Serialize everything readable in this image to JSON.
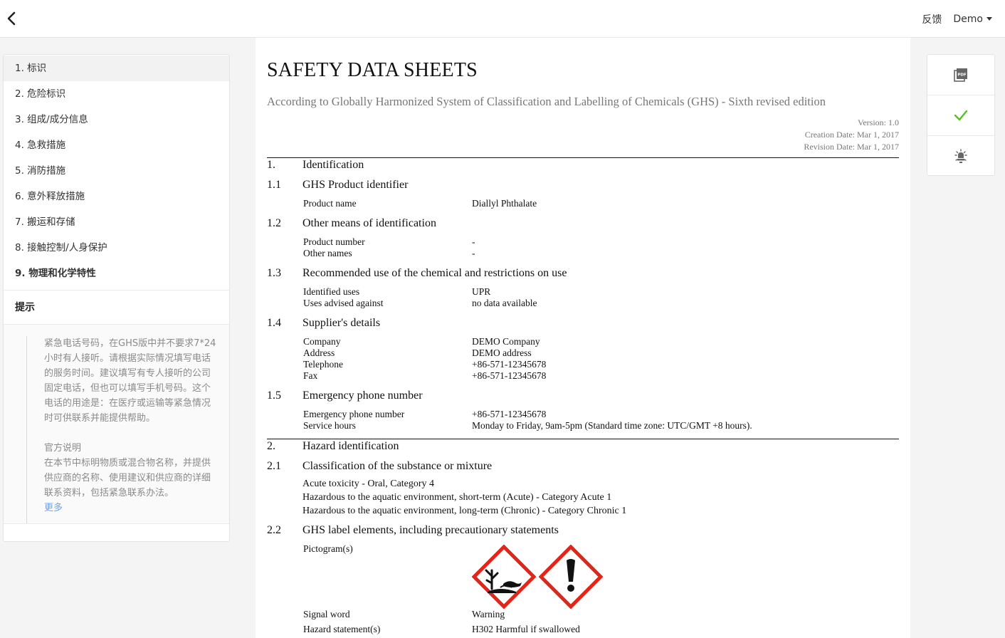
{
  "topbar": {
    "feedback": "反馈",
    "user": "Demo"
  },
  "sidebar": {
    "items": [
      {
        "label": "1. 标识"
      },
      {
        "label": "2. 危险标识"
      },
      {
        "label": "3. 组成/成分信息"
      },
      {
        "label": "4. 急救措施"
      },
      {
        "label": "5. 消防措施"
      },
      {
        "label": "6. 意外释放措施"
      },
      {
        "label": "7. 搬运和存储"
      },
      {
        "label": "8. 接触控制/人身保护"
      },
      {
        "label": "9. 物理和化学特性"
      }
    ],
    "tips_title": "提示",
    "tips_p1": "紧急电话号码，在GHS版中并不要求7*24小时有人接听。请根据实际情况填写电话的服务时间。建议填写有专人接听的公司固定电话，但也可以填写手机号码。这个电话的用途是：在医疗或运输等紧急情况时可供联系并能提供帮助。",
    "tips_p2_title": "官方说明",
    "tips_p2": "在本节中标明物质或混合物名称，并提供供应商的名称、使用建议和供应商的详细联系资料，包括紧急联系办法。",
    "tips_more": "更多"
  },
  "doc": {
    "title": "SAFETY DATA SHEETS",
    "subtitle": "According to Globally Harmonized System of Classification and Labelling of Chemicals (GHS) - Sixth revised edition",
    "version": "Version: 1.0",
    "creation": "Creation Date: Mar 1, 2017",
    "revision": "Revision Date: Mar 1, 2017",
    "s1_num": "1.",
    "s1_title": "Identification",
    "s11_num": "1.1",
    "s11_title": "GHS Product identifier",
    "product_name_label": "Product name",
    "product_name": "Diallyl Phthalate",
    "s12_num": "1.2",
    "s12_title": "Other means of identification",
    "product_number_label": "Product number",
    "product_number": "-",
    "other_names_label": "Other names",
    "other_names": "-",
    "s13_num": "1.3",
    "s13_title": "Recommended use of the chemical and restrictions on use",
    "identified_uses_label": "Identified uses",
    "identified_uses": "UPR",
    "uses_advised_label": "Uses advised against",
    "uses_advised": "no data available",
    "s14_num": "1.4",
    "s14_title": "Supplier's details",
    "company_label": "Company",
    "company": "DEMO Company",
    "address_label": "Address",
    "address": "DEMO address",
    "telephone_label": "Telephone",
    "telephone": "+86-571-12345678",
    "fax_label": "Fax",
    "fax": "+86-571-12345678",
    "s15_num": "1.5",
    "s15_title": "Emergency phone number",
    "emergency_label": "Emergency phone number",
    "emergency": "+86-571-12345678",
    "service_label": "Service hours",
    "service": "Monday to Friday, 9am-5pm (Standard time zone: UTC/GMT +8 hours).",
    "s2_num": "2.",
    "s2_title": "Hazard identification",
    "s21_num": "2.1",
    "s21_title": "Classification of the substance or mixture",
    "class1": "Acute toxicity - Oral, Category 4",
    "class2": "Hazardous to the aquatic environment, short-term (Acute) - Category Acute 1",
    "class3": "Hazardous to the aquatic environment, long-term (Chronic) - Category Chronic 1",
    "s22_num": "2.2",
    "s22_title": "GHS label elements, including precautionary statements",
    "pictogram_label": "Pictogram(s)",
    "signal_label": "Signal word",
    "signal": "Warning",
    "hazard_label": "Hazard statement(s)",
    "hazard": "H302 Harmful if swallowed"
  },
  "tools": {
    "icons": [
      "pdf-icon",
      "check-icon",
      "bulb-icon"
    ]
  },
  "colors": {
    "accent_blue": "#6ea1e8",
    "check_green": "#52c41a",
    "ghs_red": "#e0261b"
  }
}
